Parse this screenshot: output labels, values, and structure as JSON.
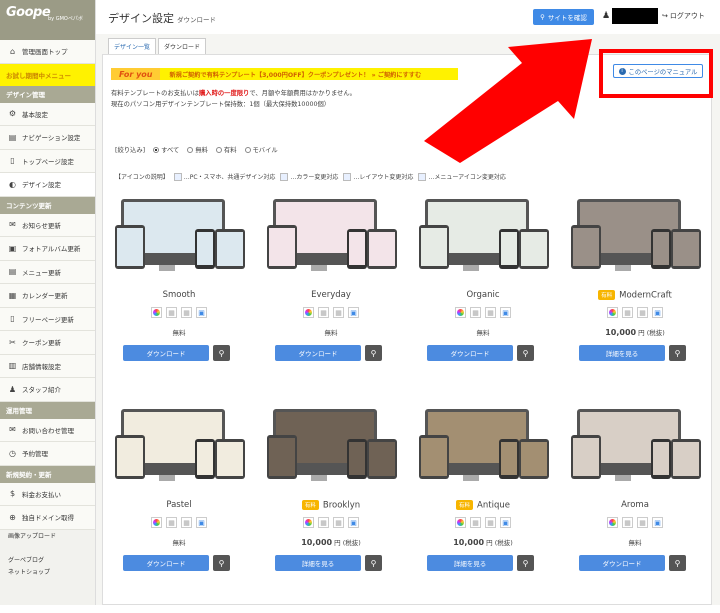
{
  "app": {
    "logo": "Goope",
    "logo_sub": "by GMOペパボ"
  },
  "header": {
    "title": "デザイン設定",
    "subtitle": "ダウンロード",
    "site_button": "サイトを確認",
    "logout": "ログアウト"
  },
  "sidebar": {
    "items": [
      {
        "type": "item",
        "label": "管理画面トップ",
        "icon": "home-icon",
        "glyph": "⌂"
      },
      {
        "type": "trial",
        "label": "お試し期間中メニュー"
      },
      {
        "type": "head",
        "label": "デザイン管理"
      },
      {
        "type": "item",
        "label": "基本設定",
        "icon": "gear-icon",
        "glyph": "⚙"
      },
      {
        "type": "item",
        "label": "ナビゲーション設定",
        "icon": "nav-icon",
        "glyph": "▤"
      },
      {
        "type": "item",
        "label": "トップページ設定",
        "icon": "page-icon",
        "glyph": "▯"
      },
      {
        "type": "item",
        "label": "デザイン設定",
        "icon": "design-icon",
        "glyph": "◐",
        "active": true
      },
      {
        "type": "head",
        "label": "コンテンツ更新"
      },
      {
        "type": "item",
        "label": "お知らせ更新",
        "icon": "chat-icon",
        "glyph": "✉"
      },
      {
        "type": "item",
        "label": "フォトアルバム更新",
        "icon": "photo-icon",
        "glyph": "▣"
      },
      {
        "type": "item",
        "label": "メニュー更新",
        "icon": "menu-icon",
        "glyph": "▤"
      },
      {
        "type": "item",
        "label": "カレンダー更新",
        "icon": "calendar-icon",
        "glyph": "▦"
      },
      {
        "type": "item",
        "label": "フリーページ更新",
        "icon": "page-icon",
        "glyph": "▯"
      },
      {
        "type": "item",
        "label": "クーポン更新",
        "icon": "coupon-icon",
        "glyph": "✂"
      },
      {
        "type": "item",
        "label": "店舗情報設定",
        "icon": "store-icon",
        "glyph": "▥"
      },
      {
        "type": "item",
        "label": "スタッフ紹介",
        "icon": "staff-icon",
        "glyph": "♟"
      },
      {
        "type": "head",
        "label": "運用管理"
      },
      {
        "type": "item",
        "label": "お問い合わせ管理",
        "icon": "mail-icon",
        "glyph": "✉"
      },
      {
        "type": "item",
        "label": "予約管理",
        "icon": "clock-icon",
        "glyph": "◷"
      },
      {
        "type": "head",
        "label": "新規契約・更新"
      },
      {
        "type": "item",
        "label": "料金お支払い",
        "icon": "money-icon",
        "glyph": "$"
      },
      {
        "type": "item",
        "label": "独自ドメイン取得",
        "icon": "globe-icon",
        "glyph": "⊕"
      },
      {
        "type": "text",
        "label": "画像アップロード"
      },
      {
        "type": "text",
        "label": ""
      },
      {
        "type": "text",
        "label": "グーペブログ"
      },
      {
        "type": "text",
        "label": "ネットショップ"
      }
    ]
  },
  "tabs": [
    "デザイン一覧",
    "ダウンロード"
  ],
  "banner": {
    "foryou": "For you",
    "text": "新規ご契約で有料テンプレート【3,000円OFF】クーポンプレゼント！ » ご契約にすすむ"
  },
  "notes": {
    "line1_a": "有料テンプレートのお支払いは",
    "line1_red": "購入時の一度限り",
    "line1_b": "で、月額や年額費用はかかりません。",
    "line2": "現在のパソコン用デザインテンプレート保持数：1個（最大保持数10000個）"
  },
  "manual": "このページのマニュアル",
  "filter": {
    "label": "[絞り込み]",
    "options": [
      {
        "label": "すべて",
        "on": true
      },
      {
        "label": "無料",
        "on": false
      },
      {
        "label": "有料",
        "on": false
      },
      {
        "label": "モバイル",
        "on": false
      }
    ]
  },
  "legend": {
    "label": "【アイコンの説明】",
    "items": [
      "…PC・スマホ、共通デザイン対応",
      "…カラー変更対応",
      "…レイアウト変更対応",
      "…メニューアイコン変更対応"
    ]
  },
  "cards": [
    {
      "name": "Smooth",
      "paid": false,
      "price": "無料",
      "button": "ダウンロード",
      "screen": "#dce8ef"
    },
    {
      "name": "Everyday",
      "paid": false,
      "price": "無料",
      "button": "ダウンロード",
      "screen": "#f3e4e9"
    },
    {
      "name": "Organic",
      "paid": false,
      "price": "無料",
      "button": "ダウンロード",
      "screen": "#e6ebe5"
    },
    {
      "name": "ModernCraft",
      "paid": true,
      "price": "10,000",
      "button": "詳細を見る",
      "screen": "#9a9088"
    },
    {
      "name": "Pastel",
      "paid": false,
      "price": "無料",
      "button": "ダウンロード",
      "screen": "#f1ecdf"
    },
    {
      "name": "Brooklyn",
      "paid": true,
      "price": "10,000",
      "button": "詳細を見る",
      "screen": "#6f6255"
    },
    {
      "name": "Antique",
      "paid": true,
      "price": "10,000",
      "button": "詳細を見る",
      "screen": "#a38f72"
    },
    {
      "name": "Aroma",
      "paid": false,
      "price": "無料",
      "button": "ダウンロード",
      "screen": "#d8cfc6"
    }
  ],
  "paid_badge": "有料",
  "price_unit": "円 (税抜)"
}
